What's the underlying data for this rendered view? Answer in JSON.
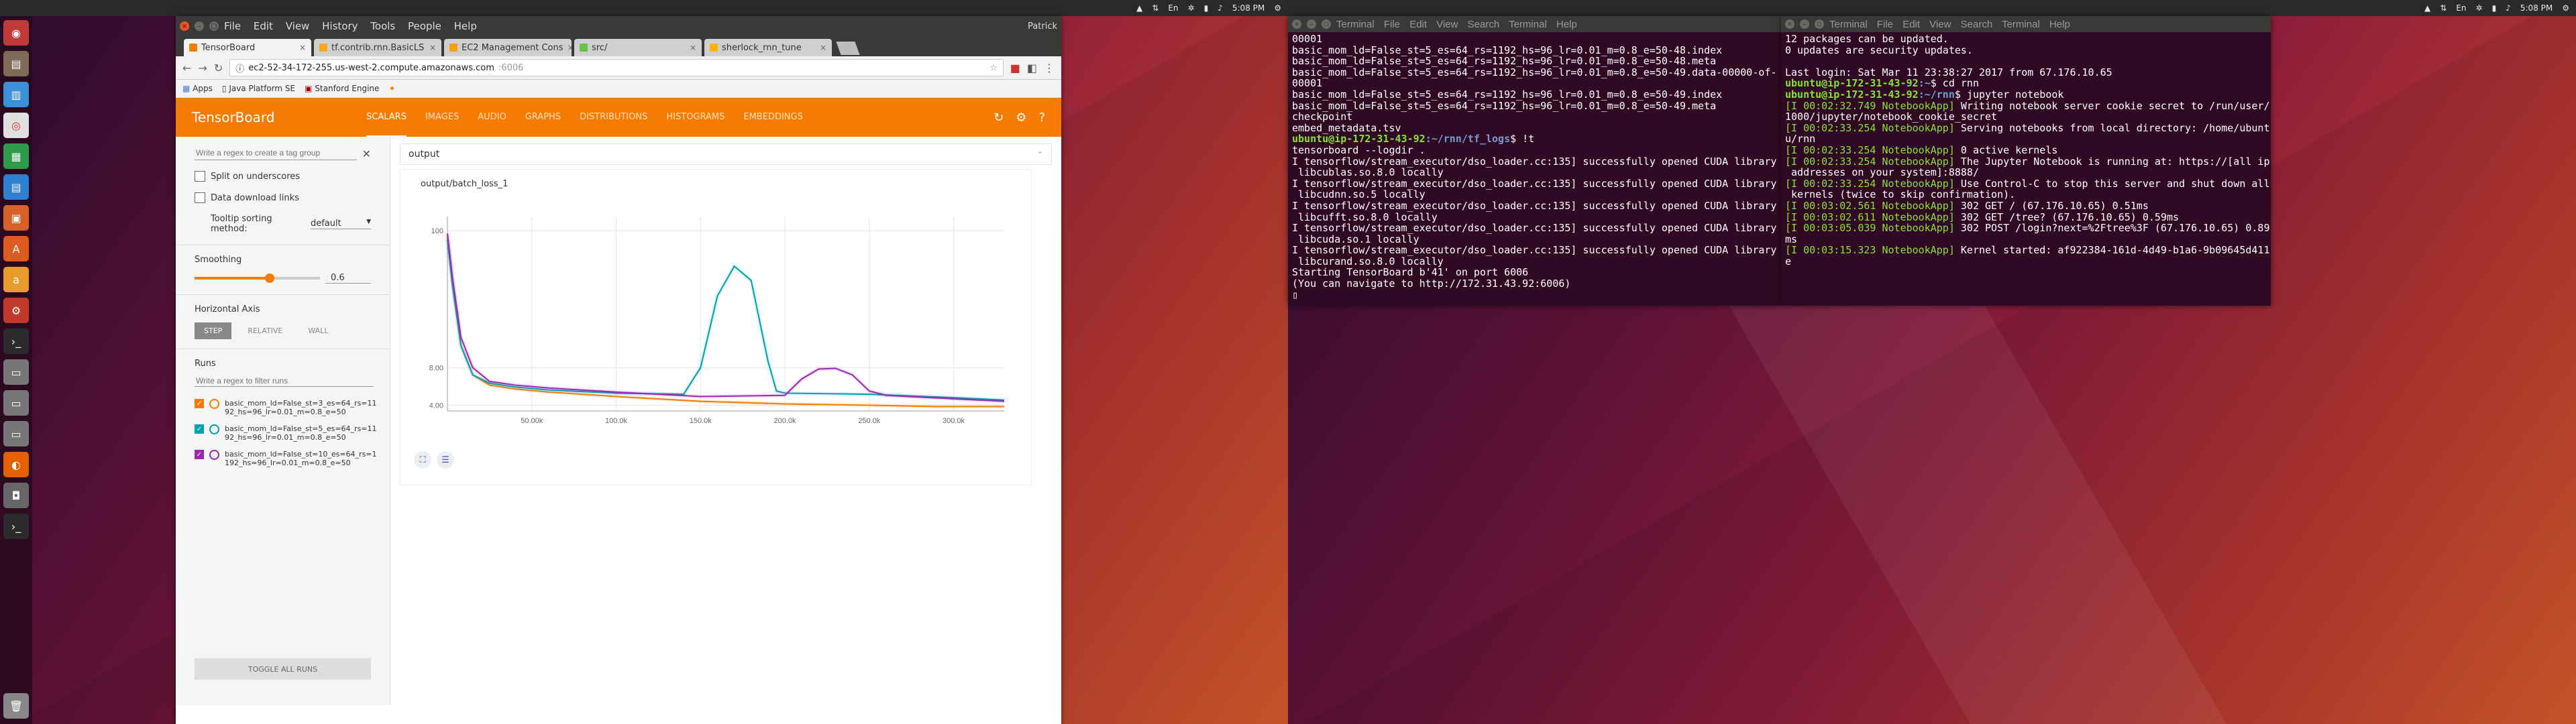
{
  "screen": {
    "clock_left": "5:08 PM",
    "clock_right": "5:08 PM",
    "tray_left": [
      "▲",
      "⇅",
      "En",
      "✲",
      "▮",
      "♪"
    ],
    "tray_right": [
      "▲",
      "⇅",
      "En",
      "✲",
      "▮",
      "♪"
    ]
  },
  "launcher": {
    "icons": [
      "dash-icon",
      "files-icon",
      "document-icon",
      "chrome-icon",
      "spreadsheet-icon",
      "document-icon",
      "presentation-icon",
      "software-center-icon",
      "amazon-icon",
      "settings-icon",
      "terminal-icon",
      "drive-icon",
      "drive-icon",
      "drive-icon",
      "firefox-icon",
      "camera-icon",
      "terminal-icon"
    ],
    "trash_icon": "trash-icon"
  },
  "chrome": {
    "menu": [
      "File",
      "Edit",
      "View",
      "History",
      "Tools",
      "People",
      "Help"
    ],
    "user": "Patrick",
    "tabs": [
      {
        "label": "TensorBoard",
        "color": "#f57c00"
      },
      {
        "label": "tf.contrib.rnn.BasicLS",
        "color": "#f5a623"
      },
      {
        "label": "EC2 Management Cons",
        "color": "#f0a30a"
      },
      {
        "label": "src/",
        "color": "#6cc04a"
      },
      {
        "label": "sherlock_rnn_tune",
        "color": "#ffb400"
      }
    ],
    "url_host": "ec2-52-34-172-255.us-west-2.compute.amazonaws.com",
    "url_port": ":6006",
    "bookmarks": [
      "Apps",
      "Java Platform SE",
      "Stanford Engine",
      ""
    ]
  },
  "tensorboard": {
    "title": "TensorBoard",
    "nav": [
      "SCALARS",
      "IMAGES",
      "AUDIO",
      "GRAPHS",
      "DISTRIBUTIONS",
      "HISTOGRAMS",
      "EMBEDDINGS"
    ],
    "accent": "#f57c00",
    "regex_placeholder": "Write a regex to create a tag group",
    "split_label": "Split on underscores",
    "download_label": "Data download links",
    "tooltip_label": "Tooltip sorting method:",
    "tooltip_value": "default",
    "smoothing_label": "Smoothing",
    "smoothing_value": "0.6",
    "smoothing_fraction": 0.6,
    "axis_label": "Horizontal Axis",
    "axis_options": [
      "STEP",
      "RELATIVE",
      "WALL"
    ],
    "runs_label": "Runs",
    "runs_placeholder": "Write a regex to filter runs",
    "runs": [
      {
        "line1": "basic_mom_ld=False_st=3_es=64_rs=11",
        "line2": "92_hs=96_lr=0.01_m=0.8_e=50",
        "color": "#f57c00"
      },
      {
        "line1": "basic_mom_ld=False_st=5_es=64_rs=11",
        "line2": "92_hs=96_lr=0.01_m=0.8_e=50",
        "color": "#00a0b0"
      },
      {
        "line1": "basic_mom_ld=False_st=10_es=64_rs=1",
        "line2": "192_hs=96_lr=0.01_m=0.8_e=50",
        "color": "#9c27b0"
      }
    ],
    "toggle_all": "TOGGLE ALL RUNS",
    "group": "output",
    "card_title": "output/batch_loss_1"
  },
  "chart_data": {
    "type": "line",
    "title": "output/batch_loss_1",
    "xlabel": "",
    "ylabel": "",
    "y_scale": "log",
    "x_tick_labels": [
      "50.00k",
      "100.0k",
      "150.0k",
      "200.0k",
      "250.0k",
      "300.0k"
    ],
    "y_tick_labels": [
      "4.00",
      "8.00",
      "100"
    ],
    "xlim": [
      0,
      330000
    ],
    "ylim": [
      3.6,
      130
    ],
    "series": [
      {
        "color": "#f57c00",
        "x": [
          0,
          3000,
          8000,
          15000,
          25000,
          40000,
          60000,
          100000,
          150000,
          200000,
          250000,
          290000,
          330000
        ],
        "y": [
          90,
          40,
          12,
          7,
          5.8,
          5.4,
          5.1,
          4.7,
          4.3,
          4.1,
          4.0,
          3.9,
          3.9
        ]
      },
      {
        "color": "#00a0b0",
        "x": [
          0,
          3000,
          8000,
          15000,
          25000,
          40000,
          60000,
          100000,
          140000,
          150000,
          160000,
          170000,
          180000,
          190000,
          195000,
          200000,
          250000,
          300000,
          330000
        ],
        "y": [
          85,
          36,
          12,
          7,
          6.0,
          5.6,
          5.3,
          5.0,
          4.9,
          8,
          30,
          52,
          40,
          9,
          5.2,
          5.0,
          4.9,
          4.6,
          4.4
        ]
      },
      {
        "color": "#9c27b0",
        "x": [
          0,
          3000,
          8000,
          15000,
          25000,
          40000,
          60000,
          100000,
          150000,
          200000,
          210000,
          220000,
          230000,
          240000,
          250000,
          260000,
          300000,
          330000
        ],
        "y": [
          95,
          42,
          14,
          8,
          6.2,
          5.8,
          5.5,
          5.1,
          4.7,
          4.8,
          6.5,
          7.8,
          7.9,
          7.0,
          5.2,
          4.8,
          4.5,
          4.3
        ]
      }
    ]
  },
  "terminal1": {
    "menu": [
      "Terminal",
      "File",
      "Edit",
      "View",
      "Search",
      "Terminal",
      "Help"
    ],
    "lines_a": [
      "00001",
      "basic_mom_ld=False_st=5_es=64_rs=1192_hs=96_lr=0.01_m=0.8_e=50-48.index",
      "basic_mom_ld=False_st=5_es=64_rs=1192_hs=96_lr=0.01_m=0.8_e=50-48.meta",
      "basic_mom_ld=False_st=5_es=64_rs=1192_hs=96_lr=0.01_m=0.8_e=50-49.data-00000-of-",
      "00001",
      "basic_mom_ld=False_st=5_es=64_rs=1192_hs=96_lr=0.01_m=0.8_e=50-49.index",
      "basic_mom_ld=False_st=5_es=64_rs=1192_hs=96_lr=0.01_m=0.8_e=50-49.meta",
      "checkpoint",
      "embed_metadata.tsv"
    ],
    "prompt_user": "ubuntu@ip-172-31-43-92",
    "prompt_path": ":~/rnn/tf_logs",
    "prompt_cmd": "$ !t",
    "lines_b": [
      "tensorboard --logdir .",
      "I tensorflow/stream_executor/dso_loader.cc:135] successfully opened CUDA library",
      " libcublas.so.8.0 locally",
      "I tensorflow/stream_executor/dso_loader.cc:135] successfully opened CUDA library",
      " libcudnn.so.5 locally",
      "I tensorflow/stream_executor/dso_loader.cc:135] successfully opened CUDA library",
      " libcufft.so.8.0 locally",
      "I tensorflow/stream_executor/dso_loader.cc:135] successfully opened CUDA library",
      " libcuda.so.1 locally",
      "I tensorflow/stream_executor/dso_loader.cc:135] successfully opened CUDA library",
      " libcurand.so.8.0 locally",
      "Starting TensorBoard b'41' on port 6006",
      "(You can navigate to http://172.31.43.92:6006)"
    ]
  },
  "terminal2": {
    "menu": [
      "Terminal",
      "File",
      "Edit",
      "View",
      "Search",
      "Terminal",
      "Help"
    ],
    "lines_a": [
      "12 packages can be updated.",
      "0 updates are security updates.",
      "",
      "Last login: Sat Mar 11 23:38:27 2017 from 67.176.10.65"
    ],
    "p1_user": "ubuntu@ip-172-31-43-92",
    "p1_path": ":~",
    "p1_cmd": "$ cd rnn",
    "p2_user": "ubuntu@ip-172-31-43-92",
    "p2_path": ":~/rnn",
    "p2_cmd": "$ jupyter notebook",
    "log": [
      {
        "tag": "[I 00:02:32.749 NotebookApp]",
        "msg": " Writing notebook server cookie secret to /run/user/"
      },
      {
        "tag": "",
        "msg": "1000/jupyter/notebook_cookie_secret"
      },
      {
        "tag": "[I 00:02:33.254 NotebookApp]",
        "msg": " Serving notebooks from local directory: /home/ubunt"
      },
      {
        "tag": "",
        "msg": "u/rnn"
      },
      {
        "tag": "[I 00:02:33.254 NotebookApp]",
        "msg": " 0 active kernels"
      },
      {
        "tag": "[I 00:02:33.254 NotebookApp]",
        "msg": " The Jupyter Notebook is running at: https://[all ip"
      },
      {
        "tag": "",
        "msg": " addresses on your system]:8888/"
      },
      {
        "tag": "[I 00:02:33.254 NotebookApp]",
        "msg": " Use Control-C to stop this server and shut down all"
      },
      {
        "tag": "",
        "msg": " kernels (twice to skip confirmation)."
      },
      {
        "tag": "[I 00:03:02.561 NotebookApp]",
        "msg": " 302 GET / (67.176.10.65) 0.51ms"
      },
      {
        "tag": "[I 00:03:02.611 NotebookApp]",
        "msg": " 302 GET /tree? (67.176.10.65) 0.59ms"
      },
      {
        "tag": "[I 00:03:05.039 NotebookApp]",
        "msg": " 302 POST /login?next=%2Ftree%3F (67.176.10.65) 0.89"
      },
      {
        "tag": "",
        "msg": "ms"
      },
      {
        "tag": "[I 00:03:15.323 NotebookApp]",
        "msg": " Kernel started: af922384-161d-4d49-b1a6-9b09645d411"
      },
      {
        "tag": "",
        "msg": "e"
      }
    ]
  }
}
